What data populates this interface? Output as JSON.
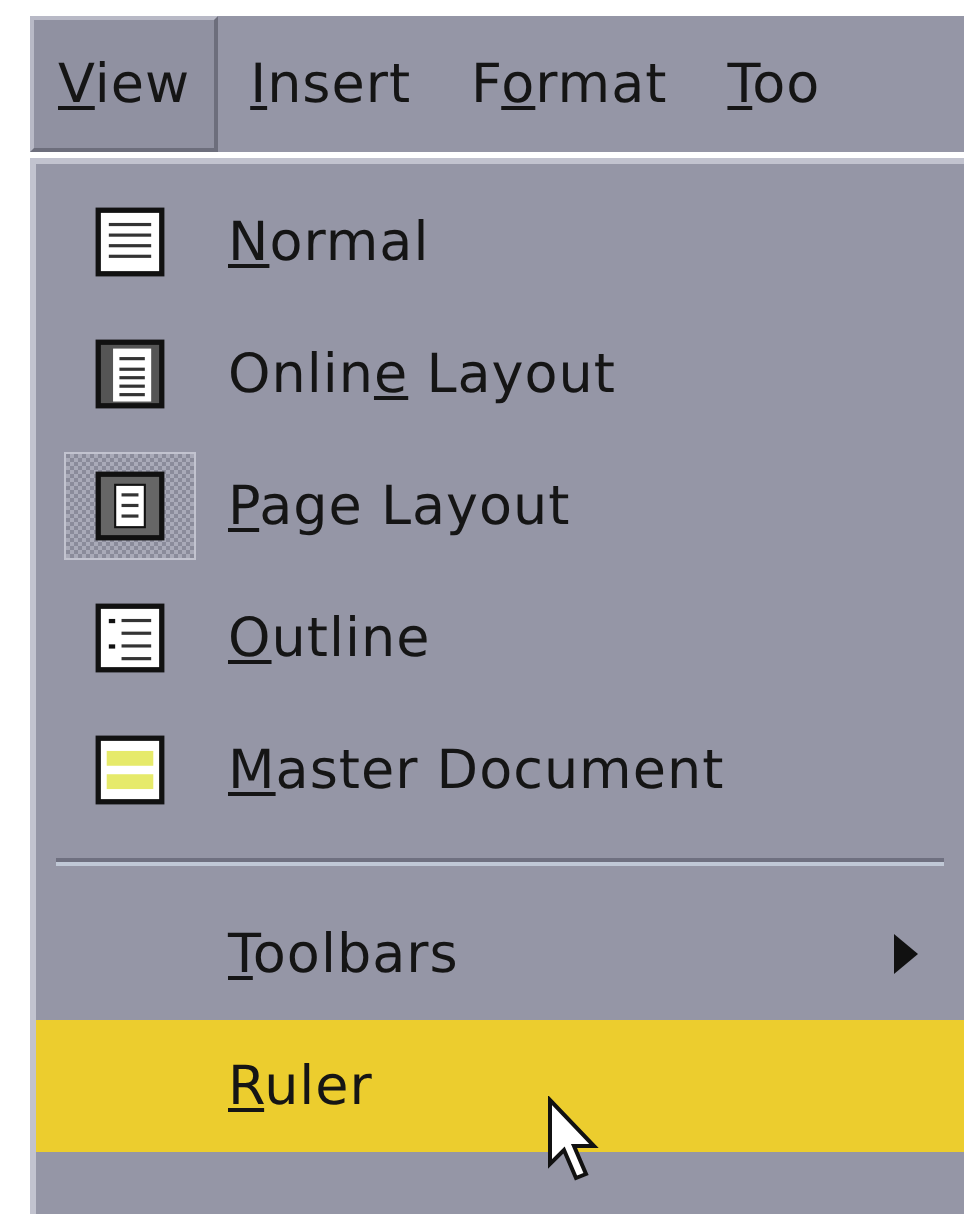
{
  "menubar": [
    {
      "key": "V",
      "post": "iew",
      "open": true
    },
    {
      "key": "I",
      "post": "nsert",
      "open": false
    },
    {
      "pre": "F",
      "key": "o",
      "post": "rmat",
      "open": false
    },
    {
      "key": "T",
      "post": "oo",
      "open": false
    }
  ],
  "menu": [
    {
      "kind": "view",
      "key": "N",
      "post": "ormal",
      "checked": false,
      "highlighted": false
    },
    {
      "kind": "view",
      "pre": "Onlin",
      "key": "e",
      "post": " Layout",
      "checked": false,
      "highlighted": false
    },
    {
      "kind": "view",
      "key": "P",
      "post": "age Layout",
      "checked": true,
      "highlighted": false
    },
    {
      "kind": "view",
      "key": "O",
      "post": "utline",
      "checked": false,
      "highlighted": false
    },
    {
      "kind": "view",
      "key": "M",
      "post": "aster Document",
      "checked": false,
      "highlighted": false
    },
    {
      "kind": "separator"
    },
    {
      "kind": "submenu",
      "key": "T",
      "post": "oolbars",
      "highlighted": false
    },
    {
      "kind": "plain",
      "key": "R",
      "post": "uler",
      "highlighted": true
    }
  ]
}
